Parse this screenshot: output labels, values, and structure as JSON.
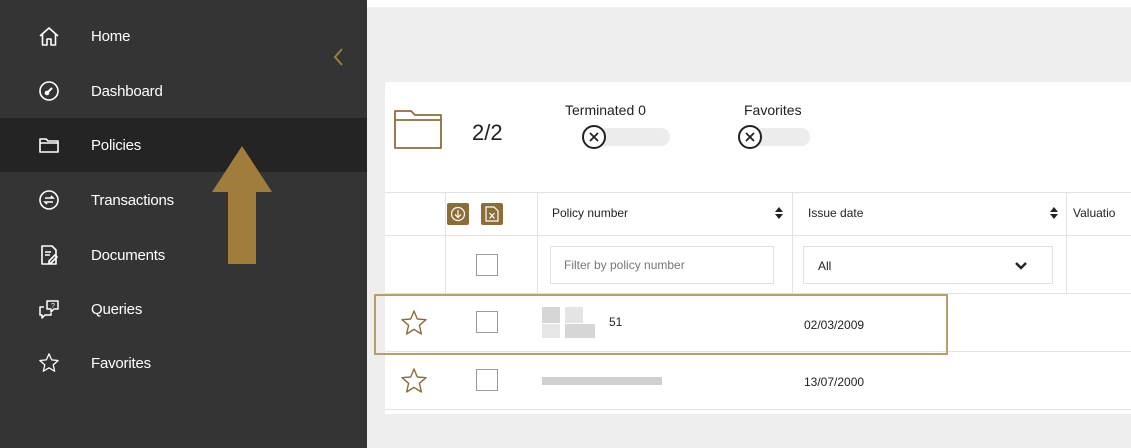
{
  "sidebar": {
    "items": [
      {
        "label": "Home",
        "icon": "home-icon"
      },
      {
        "label": "Dashboard",
        "icon": "dashboard-icon"
      },
      {
        "label": "Policies",
        "icon": "folder-icon",
        "active": true
      },
      {
        "label": "Transactions",
        "icon": "transactions-icon"
      },
      {
        "label": "Documents",
        "icon": "document-icon"
      },
      {
        "label": "Queries",
        "icon": "queries-icon"
      },
      {
        "label": "Favorites",
        "icon": "star-icon"
      }
    ],
    "collapse_icon": "chevron-left-icon"
  },
  "summary": {
    "count": "2/2",
    "terminated_label": "Terminated 0",
    "favorites_label": "Favorites"
  },
  "table": {
    "columns": {
      "policy_number": "Policy number",
      "issue_date": "Issue date",
      "valuation": "Valuatio"
    },
    "filter": {
      "policy_placeholder": "Filter by policy number",
      "issue_date_value": "All"
    },
    "rows": [
      {
        "policy_suffix": "51",
        "issue_date": "02/03/2009"
      },
      {
        "policy_suffix": "",
        "issue_date": "13/07/2000"
      }
    ]
  },
  "colors": {
    "sidebar_bg": "#343434",
    "sidebar_active": "#242424",
    "accent_gold": "#8b6d3a",
    "highlight_border": "#b89e6a",
    "arrow_gold": "#a07d3a"
  }
}
